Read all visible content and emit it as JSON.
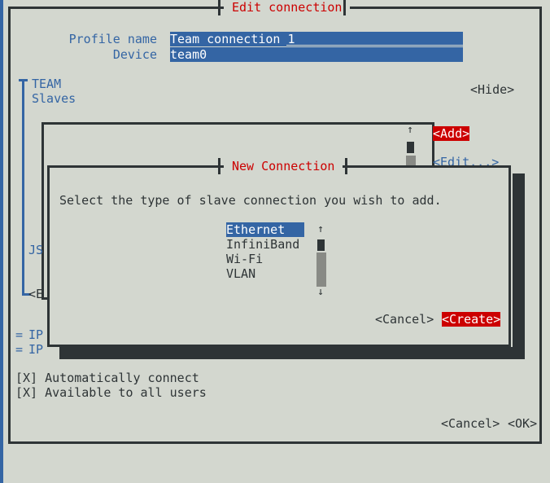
{
  "window": {
    "title": "Edit connection",
    "fields": [
      {
        "label": "Profile name",
        "value": "Team connection 1"
      },
      {
        "label": "Device",
        "value": "team0"
      }
    ],
    "sections": [
      {
        "marker": "=",
        "label_line1": "TEAM",
        "label_line2": "Slaves",
        "toggle": "<Hide>"
      }
    ],
    "partially_hidden": {
      "json_label": "JS",
      "edit_button": "<E",
      "ip_row1_marker": "=",
      "ip_row1_label": "IP",
      "ip_row2_marker": "=",
      "ip_row2_label": "IP"
    },
    "slaves_buttons": {
      "add": "<Add>",
      "edit": "<Edit...>"
    },
    "checkboxes": [
      {
        "mark": "[X]",
        "label": "Automatically connect"
      },
      {
        "mark": "[X]",
        "label": "Available to all users"
      }
    ],
    "footer_buttons": {
      "cancel": "<Cancel>",
      "ok": "<OK>"
    },
    "scrollbar": {
      "up_arrow": "↑",
      "down_arrow": "↓"
    }
  },
  "dialog": {
    "title": "New Connection",
    "prompt": "Select the type of slave connection you wish to add.",
    "list": [
      {
        "label": "Ethernet",
        "selected": true
      },
      {
        "label": "InfiniBand",
        "selected": false
      },
      {
        "label": "Wi-Fi",
        "selected": false
      },
      {
        "label": "VLAN",
        "selected": false
      }
    ],
    "scrollbar": {
      "up_arrow": "↑",
      "down_arrow": "↓"
    },
    "buttons": {
      "cancel": "<Cancel>",
      "create": "<Create>"
    }
  },
  "colors": {
    "background": "#d3d7cf",
    "foreground": "#2e3436",
    "accent_blue": "#3465a4",
    "accent_red": "#cc0000",
    "white": "#ffffff",
    "scroll_thumb": "#888a85"
  }
}
